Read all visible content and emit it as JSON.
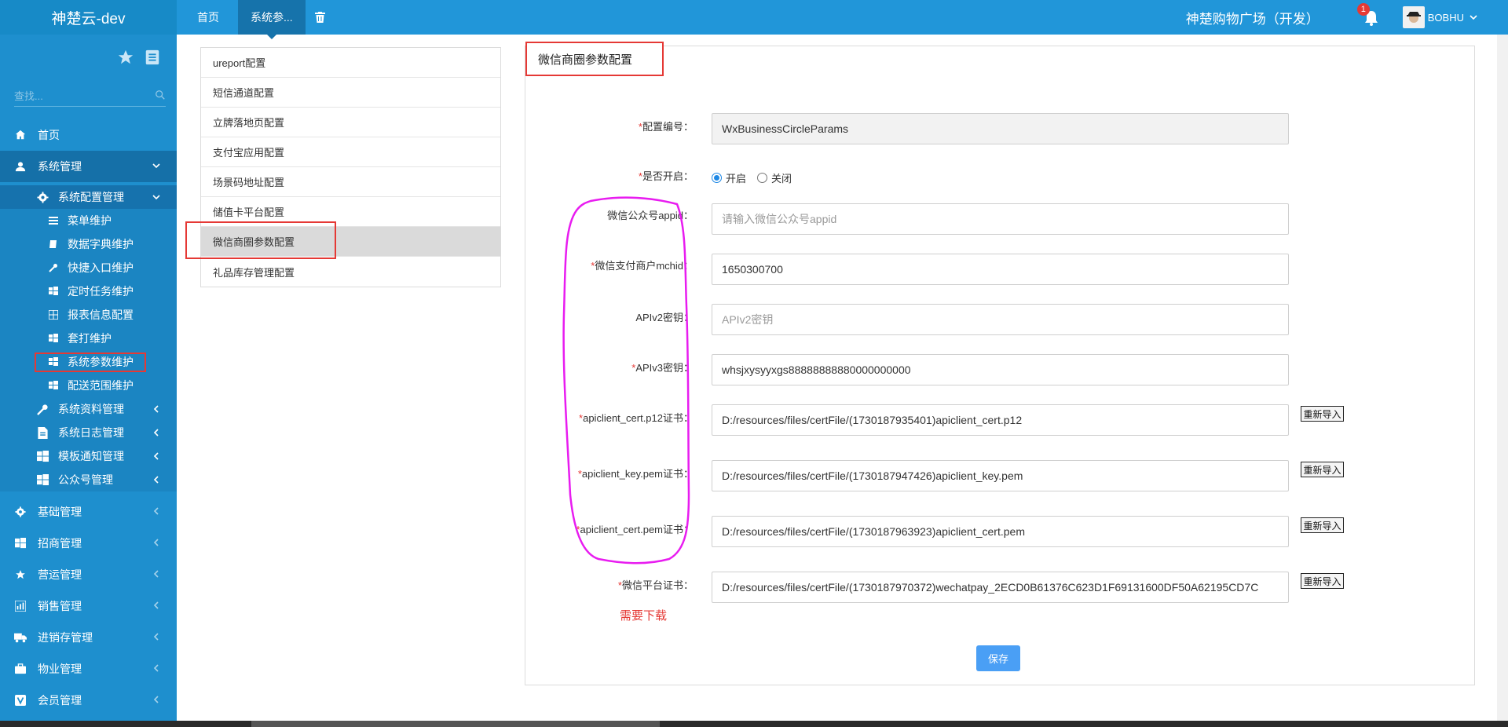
{
  "app": {
    "brand": "神楚云-dev",
    "mall_name": "神楚购物广场（开发）",
    "notification_count": "1",
    "user_name": "BOBHU"
  },
  "sidebar": {
    "search_placeholder": "查找...",
    "home": "首页",
    "system_management": "系统管理",
    "system_config_management": "系统配置管理",
    "config_children": [
      "菜单维护",
      "数据字典维护",
      "快捷入口维护",
      "定时任务维护",
      "报表信息配置",
      "套打维护",
      "系统参数维护",
      "配送范围维护"
    ],
    "system_groups": [
      "系统资料管理",
      "系统日志管理",
      "模板通知管理",
      "公众号管理"
    ],
    "modules": [
      "基础管理",
      "招商管理",
      "营运管理",
      "销售管理",
      "进销存管理",
      "物业管理",
      "会员管理"
    ]
  },
  "topbar": {
    "tabs": [
      "首页",
      "系统参..."
    ]
  },
  "config_list": [
    "ureport配置",
    "短信通道配置",
    "立牌落地页配置",
    "支付宝应用配置",
    "场景码地址配置",
    "储值卡平台配置",
    "微信商圈参数配置",
    "礼品库存管理配置"
  ],
  "form": {
    "title": "微信商圈参数配置",
    "fields": {
      "config_no": {
        "label": "配置编号：",
        "value": "WxBusinessCircleParams"
      },
      "enabled": {
        "label": "是否开启：",
        "on": "开启",
        "off": "关闭",
        "selected": "开启"
      },
      "appid": {
        "label": "微信公众号appid：",
        "placeholder": "请输入微信公众号appid"
      },
      "mchid": {
        "label": "微信支付商户mchid：",
        "value": "1650300700"
      },
      "apiv2": {
        "label": "APIv2密钥：",
        "placeholder": "APIv2密钥"
      },
      "apiv3": {
        "label": "APIv3密钥：",
        "value": "whsjxysyyxgs88888888880000000000"
      },
      "cert_p12": {
        "label": "apiclient_cert.p12证书：",
        "value": "D:/resources/files/certFile/(1730187935401)apiclient_cert.p12"
      },
      "key_pem": {
        "label": "apiclient_key.pem证书：",
        "value": "D:/resources/files/certFile/(1730187947426)apiclient_key.pem"
      },
      "cert_pem": {
        "label": "apiclient_cert.pem证书：",
        "value": "D:/resources/files/certFile/(1730187963923)apiclient_cert.pem"
      },
      "wechat_cert": {
        "label": "微信平台证书：",
        "value": "D:/resources/files/certFile/(1730187970372)wechatpay_2ECD0B61376C623D1F69131600DF50A62195CD7C"
      }
    },
    "reimport_label": "重新导入",
    "download_note": "需要下载",
    "save_label": "保存",
    "required_mark": "*"
  },
  "colors": {
    "sidebar": "#1e8fce",
    "topbar": "#2196d9",
    "annotation_red": "#e53935",
    "annotation_magenta": "#e81cf0",
    "save_button": "#4a9ff5"
  }
}
